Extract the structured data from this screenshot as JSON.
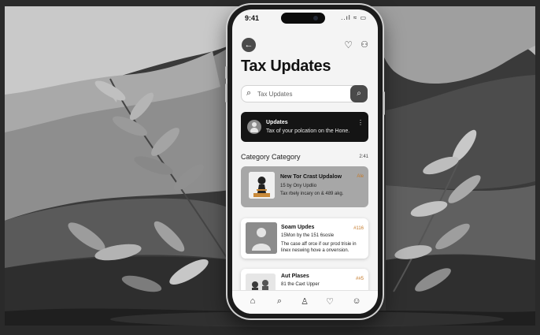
{
  "status": {
    "time": "9:41",
    "icons": "..ıl ≈ ▭"
  },
  "header": {
    "title": "Tax Updates",
    "back_icon": "back-arrow-icon",
    "heart_icon": "heart-icon",
    "user_icon": "user-icon"
  },
  "search": {
    "placeholder": "Tax Updates"
  },
  "banner": {
    "title": "Updates",
    "text": "Tax of your polcation on the Hone."
  },
  "section": {
    "title": "Category Category",
    "count": "2:41"
  },
  "cards": [
    {
      "title": "New Tor Crast Updalow",
      "tag": "Ale",
      "line1": "15 by Ony Updlio",
      "line2": "Tax rbely incary on & 489 akg."
    },
    {
      "title": "Soam Updes",
      "tag": "#116",
      "line1": "15Mon by the 151 6sosle",
      "line2": "The case aff orce if our prod trisie in",
      "line3": "linex neswing hove a onvension."
    },
    {
      "title": "Aut Plases",
      "tag": "##5",
      "line1": "81 the Caxt Upper"
    }
  ],
  "tabs": [
    "home-icon",
    "search-icon",
    "profile-icon",
    "heart-icon",
    "account-icon"
  ],
  "colors": {
    "phone": "#1b1b1b",
    "banner": "#141414",
    "card_active": "#a7a7a7",
    "background": "#2b2b2b"
  }
}
